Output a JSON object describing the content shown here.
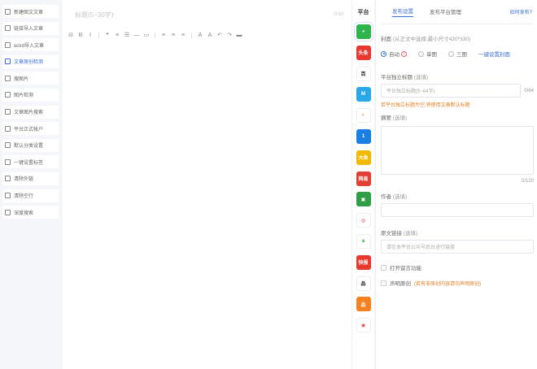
{
  "sidebar": {
    "items": [
      {
        "label": "新建图文文章",
        "icon": "edit-icon"
      },
      {
        "label": "链接导入文章",
        "icon": "link-icon"
      },
      {
        "label": "word导入文章",
        "icon": "word-icon"
      },
      {
        "label": "文章原创检测",
        "icon": "check-icon",
        "active": true
      },
      {
        "label": "搜图片",
        "icon": "image-search-icon"
      },
      {
        "label": "图片检测",
        "icon": "image-check-icon"
      },
      {
        "label": "文章图片搜索",
        "icon": "image-icon"
      },
      {
        "label": "平台正式帐户",
        "icon": "flag-icon"
      },
      {
        "label": "默认分类设置",
        "icon": "category-icon"
      },
      {
        "label": "一键设置标签",
        "icon": "tag-icon"
      },
      {
        "label": "清除外链",
        "icon": "unlink-icon"
      },
      {
        "label": "清除空行",
        "icon": "clear-icon"
      },
      {
        "label": "深度搜索",
        "icon": "search-icon"
      }
    ]
  },
  "editor": {
    "title_placeholder": "标题(5~30字)",
    "title_count": "0/30",
    "toolbar": [
      "⊟",
      "B",
      "I",
      "❝",
      "≡",
      "☰",
      "—",
      "▭",
      "≡",
      "≡",
      "≡",
      "A",
      "A",
      "↶",
      "↷",
      "▬"
    ]
  },
  "platforms": {
    "header": "平台",
    "items": [
      {
        "name": "wechat-icon",
        "color": "#2fb54b",
        "glyph": "◕"
      },
      {
        "name": "toutiao-icon",
        "color": "#e8392f",
        "glyph": "头条"
      },
      {
        "name": "baijiahao-icon",
        "color": "#ffffff",
        "glyph": "百",
        "fg": "#222"
      },
      {
        "name": "zhihu-icon",
        "color": "#2ba8e8",
        "glyph": "M"
      },
      {
        "name": "sohu-icon",
        "color": "#ffffff",
        "glyph": "◐",
        "fg": "#f28a1e"
      },
      {
        "name": "yidian-icon",
        "color": "#1a7fe0",
        "glyph": "1"
      },
      {
        "name": "dayu-icon",
        "color": "#f5b800",
        "glyph": "大鱼"
      },
      {
        "name": "wangyi-icon",
        "color": "#e33e33",
        "glyph": "网易"
      },
      {
        "name": "douban-icon",
        "color": "#2f9e44",
        "glyph": "▣"
      },
      {
        "name": "weibo-icon",
        "color": "#ffffff",
        "glyph": "◎",
        "fg": "#e6162d"
      },
      {
        "name": "aiqiyi-icon",
        "color": "#ffffff",
        "glyph": "◈",
        "fg": "#3ab54a"
      },
      {
        "name": "kuaibao-icon",
        "color": "#e8392f",
        "glyph": "快报"
      },
      {
        "name": "jianshu-icon",
        "color": "#ffffff",
        "glyph": "品",
        "fg": "#222"
      },
      {
        "name": "bilibili-icon",
        "color": "#f58220",
        "glyph": "品"
      },
      {
        "name": "netease-icon",
        "color": "#ffffff",
        "glyph": "◉",
        "fg": "#e33e33"
      }
    ]
  },
  "panel": {
    "tab_active": "发布设置",
    "tab_other": "发布平台管理",
    "tab_link": "如何发布?",
    "cover_label": "封面",
    "cover_hint": "(从正文中选择,最小尺寸420*330)",
    "radio_auto": "自动",
    "radio_single": "单图",
    "radio_triple": "三图",
    "radio_link": "一键设置封面",
    "platform_title_label": "平台独立标题",
    "platform_title_hint": "(选填)",
    "platform_title_placeholder": "平台独立标题(5~64字)",
    "platform_title_count": "0/64",
    "platform_title_warn": "若平台独立标题为空,将使用文章默认标题",
    "summary_label": "摘要",
    "summary_hint": "(选填)",
    "summary_count": "0/120",
    "author_label": "作者",
    "author_hint": "(选填)",
    "source_label": "原文链接",
    "source_hint": "(选填)",
    "source_placeholder": "请在本平台公众号后台进行链接",
    "open_comment": "打开留言功能",
    "original": "声明原创",
    "original_note": "(若有非原创内容请勿声明原创)"
  },
  "colors": {
    "accent": "#3a6fd8",
    "warn": "#e67e22"
  }
}
